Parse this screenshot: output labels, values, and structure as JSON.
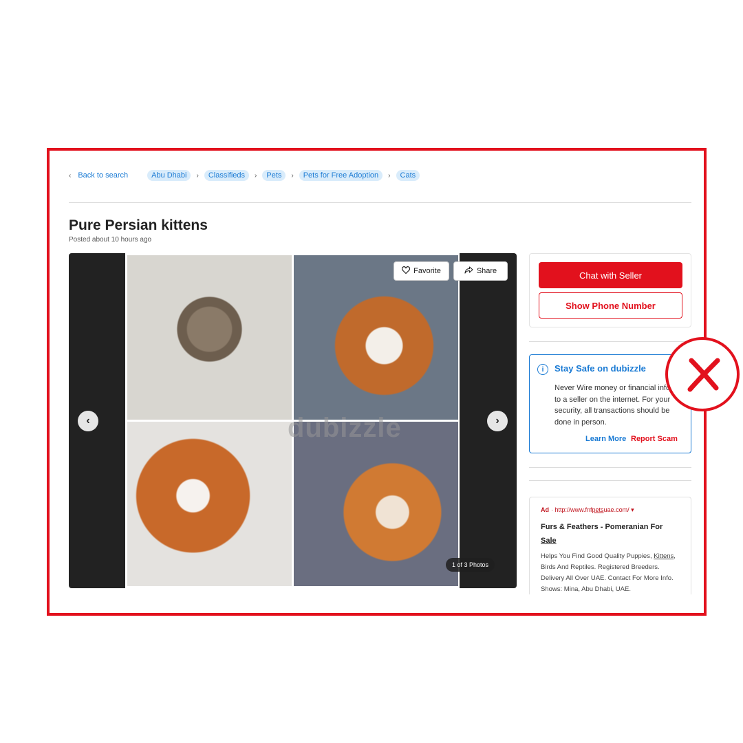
{
  "breadcrumb": {
    "back_label": "Back to search",
    "items": [
      "Abu Dhabi",
      "Classifieds",
      "Pets",
      "Pets for Free Adoption",
      "Cats"
    ]
  },
  "listing": {
    "title": "Pure Persian kittens",
    "posted": "Posted about 10 hours ago"
  },
  "gallery": {
    "favorite_label": "Favorite",
    "share_label": "Share",
    "watermark": "dubizzle",
    "counter": "1 of 3 Photos",
    "prev_icon": "chevron-left-icon",
    "next_icon": "chevron-right-icon"
  },
  "contact": {
    "chat_label": "Chat with Seller",
    "phone_label": "Show Phone Number"
  },
  "safety": {
    "title": "Stay Safe on dubizzle",
    "body": "Never Wire money or financial info to a seller on the internet. For your security, all transactions should be done in person.",
    "learn_more": "Learn More",
    "report": "Report Scam"
  },
  "ad": {
    "label": "Ad",
    "url_prefix": "http://www.fnf",
    "url_keyword": "pets",
    "url_suffix": "uae.com/",
    "title_main": "Furs & Feathers - Pomeranian For",
    "title_underlined": "Sale",
    "body_keyword": "Kittens",
    "body_rest": ", Birds And Reptiles. Registered Breeders. Delivery All Over UAE. Contact For More Info. Shows: Mina, Abu Dhabi, UAE.",
    "body_first": "Helps You Find Good Quality Puppies,"
  },
  "colors": {
    "brand_red": "#e2111d",
    "link_blue": "#1b7bd4"
  }
}
